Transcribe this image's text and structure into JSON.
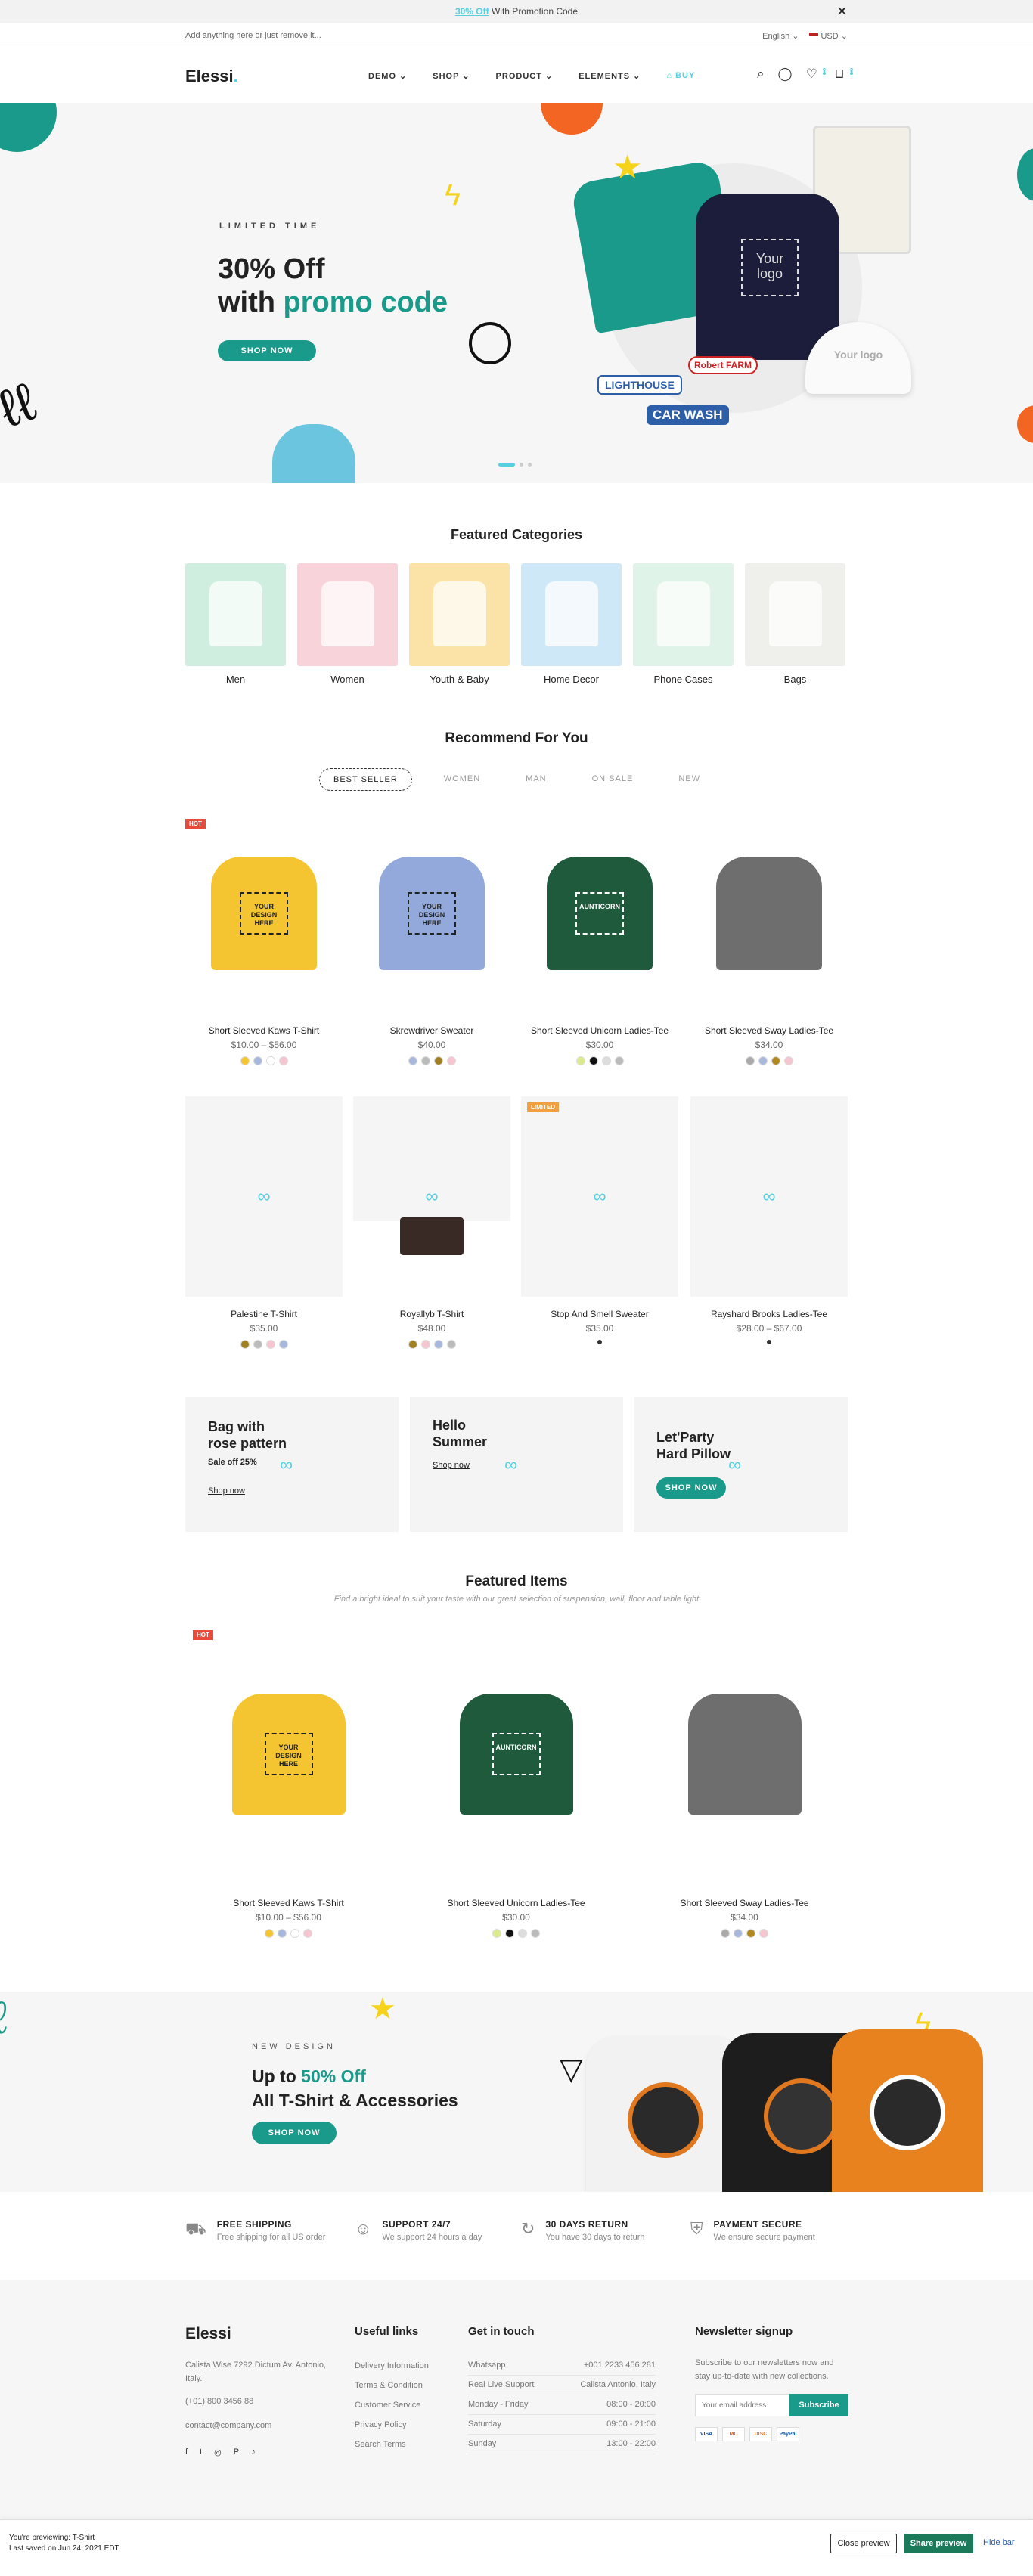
{
  "topbar": {
    "promo_link": "30% Off",
    "promo_text": " With Promotion Code",
    "close": "✕"
  },
  "utilbar": {
    "notice": "Add anything here or just remove it...",
    "language": "English",
    "currency": "USD"
  },
  "header": {
    "logo": "Elessi",
    "logo_dot": ".",
    "nav": [
      "DEMO",
      "SHOP",
      "PRODUCT",
      "ELEMENTS"
    ],
    "buy": "BUY",
    "cart_count": "0",
    "wishlist_count": "0"
  },
  "hero": {
    "eyebrow": "LIMITED TIME",
    "headline_1": "30% Off",
    "headline_2": "with ",
    "headline_highlight": "promo code",
    "button": "SHOP NOW",
    "shirt_logo": "Your logo",
    "cap_logo": "Your logo",
    "sticker_1": "LIGHTHOUSE",
    "sticker_2": "CAR WASH",
    "sticker_3": "Robert FARM"
  },
  "categories": {
    "title": "Featured Categories",
    "items": [
      {
        "label": "Men",
        "bg": "#cfeee0"
      },
      {
        "label": "Women",
        "bg": "#f9d3da"
      },
      {
        "label": "Youth & Baby",
        "bg": "#fbe3a8"
      },
      {
        "label": "Home Decor",
        "bg": "#cfe8f8"
      },
      {
        "label": "Phone Cases",
        "bg": "#dff3e8"
      },
      {
        "label": "Bags",
        "bg": "#efefeb"
      }
    ]
  },
  "recommend": {
    "title": "Recommend For You",
    "tabs": [
      "BEST SELLER",
      "WOMEN",
      "MAN",
      "ON SALE",
      "NEW"
    ]
  },
  "products": [
    {
      "name": "Short Sleeved Kaws T-Shirt",
      "price": "$10.00 – $56.00",
      "tag": "HOT",
      "shirt": "#f5c531",
      "print": "YOUR DESIGN HERE",
      "swatches": [
        "#f5c531",
        "#a8b8dc",
        "#ffffff",
        "#f5c6d0"
      ]
    },
    {
      "name": "Skrewdriver Sweater",
      "price": "$40.00",
      "shirt": "#93a9dc",
      "print": "YOUR DESIGN HERE",
      "swatches": [
        "#a8b8dc",
        "#bbbbbb",
        "#a08020",
        "#f5c6d0"
      ]
    },
    {
      "name": "Short Sleeved Unicorn Ladies-Tee",
      "price": "$30.00",
      "shirt": "#1f5a3c",
      "print": "AUNTICORN",
      "swatches": [
        "#dbeb8c",
        "#111111",
        "#dddddd",
        "#bbbbbb"
      ]
    },
    {
      "name": "Short Sleeved Sway Ladies-Tee",
      "price": "$34.00",
      "shirt": "#6e6e6e",
      "print": "",
      "swatches": [
        "#aaaaaa",
        "#a8b8dc",
        "#b08a20",
        "#f5c6d0"
      ]
    },
    {
      "name": "Palestine T-Shirt",
      "price": "$35.00",
      "swatches": [
        "#a08020",
        "#bbbbbb",
        "#f5c6d0",
        "#a8b8dc"
      ]
    },
    {
      "name": "Royallyb T-Shirt",
      "price": "$48.00",
      "swatches": [
        "#a08020",
        "#f5c6d0",
        "#a8b8dc",
        "#bbbbbb"
      ]
    },
    {
      "name": "Stop And Smell Sweater",
      "price": "$35.00",
      "tag": "LIMITED",
      "swatches": [
        "#333333"
      ]
    },
    {
      "name": "Rayshard Brooks Ladies-Tee",
      "price": "$28.00 – $67.00",
      "swatches": [
        "#333333"
      ]
    }
  ],
  "banners": [
    {
      "title_1": "Bag with",
      "title_2": "rose pattern",
      "sub": "Sale off 25%",
      "link": "Shop now"
    },
    {
      "title_1": "Hello",
      "title_2": "Summer",
      "link": "Shop now"
    },
    {
      "title_1": "Let'Party",
      "title_2": "Hard Pillow",
      "button": "SHOP NOW"
    }
  ],
  "featured": {
    "title": "Featured Items",
    "subtitle": "Find a bright ideal to suit your taste with our great selection of suspension, wall, floor and table light",
    "items": [
      {
        "name": "Short Sleeved Kaws T-Shirt",
        "price": "$10.00 – $56.00",
        "tag": "HOT",
        "shirt": "#f5c531",
        "print": "YOUR DESIGN HERE",
        "swatches": [
          "#f5c531",
          "#a8b8dc",
          "#ffffff",
          "#f5c6d0"
        ]
      },
      {
        "name": "Short Sleeved Unicorn Ladies-Tee",
        "price": "$30.00",
        "shirt": "#1f5a3c",
        "print": "AUNTICORN",
        "swatches": [
          "#dbeb8c",
          "#111111",
          "#dddddd",
          "#bbbbbb"
        ]
      },
      {
        "name": "Short Sleeved Sway Ladies-Tee",
        "price": "$34.00",
        "shirt": "#6e6e6e",
        "print": "",
        "swatches": [
          "#aaaaaa",
          "#a8b8dc",
          "#b08a20",
          "#f5c6d0"
        ]
      }
    ]
  },
  "promo": {
    "eyebrow": "NEW DESIGN",
    "line_1a": "Up to ",
    "line_1b": "50% Off",
    "line_2": "All T-Shirt & Accessories",
    "button": "SHOP NOW"
  },
  "services": [
    {
      "title": "FREE SHIPPING",
      "text": "Free shipping for all US order",
      "icon": "truck-icon"
    },
    {
      "title": "SUPPORT 24/7",
      "text": "We support 24 hours a day",
      "icon": "headset-icon"
    },
    {
      "title": "30 DAYS RETURN",
      "text": "You have 30 days to return",
      "icon": "return-icon"
    },
    {
      "title": "PAYMENT SECURE",
      "text": "We ensure secure payment",
      "icon": "shield-icon"
    }
  ],
  "footer": {
    "logo": "Elessi",
    "address": "Calista Wise 7292 Dictum Av. Antonio, Italy.",
    "phone": "(+01) 800 3456 88",
    "email": "contact@company.com",
    "useful_title": "Useful links",
    "useful": [
      "Delivery Information",
      "Terms & Condition",
      "Customer Service",
      "Privacy Policy",
      "Search Terms"
    ],
    "touch_title": "Get in touch",
    "touch": [
      [
        "Whatsapp",
        "+001 2233 456 281"
      ],
      [
        "Real Live Support",
        "Calista Antonio, Italy"
      ],
      [
        "Monday - Friday",
        "08:00 - 20:00"
      ],
      [
        "Saturday",
        "09:00 - 21:00"
      ],
      [
        "Sunday",
        "13:00 - 22:00"
      ]
    ],
    "news_title": "Newsletter signup",
    "news_text": "Subscribe to our newsletters now and stay up-to-date with new collections.",
    "email_placeholder": "Your email address",
    "subscribe": "Subscribe",
    "payments": [
      "VISA",
      "MC",
      "DISC",
      "PayPal"
    ]
  },
  "preview": {
    "line1": "You're previewing: T-Shirt",
    "line2": "Last saved on Jun 24, 2021 EDT",
    "close": "Close preview",
    "share": "Share preview",
    "hide": "Hide bar"
  },
  "colors": {
    "accent": "#56cfe1",
    "teal": "#1a9a8a",
    "hot": "#e84b3c",
    "limited": "#f0a040"
  }
}
